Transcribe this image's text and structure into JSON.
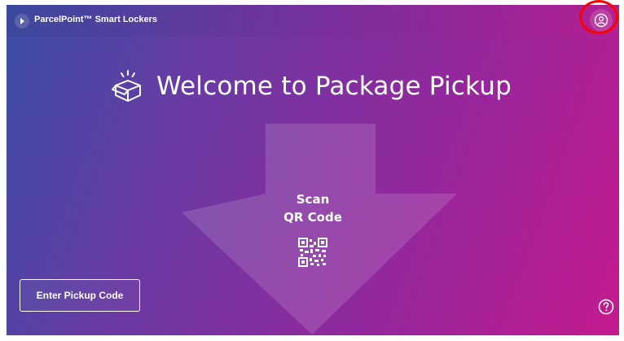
{
  "header": {
    "brand_name": "ParcelPoint™ Smart Lockers",
    "logo_icon": "parcelpoint-logo-icon",
    "account_icon": "user-account-icon"
  },
  "main": {
    "title": "Welcome to Package Pickup",
    "title_icon": "package-box-icon",
    "scan_line1": "Scan",
    "scan_line2": "QR Code",
    "qr_icon": "qr-code-icon"
  },
  "footer": {
    "pickup_button_label": "Enter Pickup Code",
    "help_icon": "help-question-icon"
  },
  "colors": {
    "gradient_start": "#3a4ea6",
    "gradient_mid": "#93279d",
    "gradient_end": "#c41a8e",
    "highlight": "#ff0000"
  }
}
